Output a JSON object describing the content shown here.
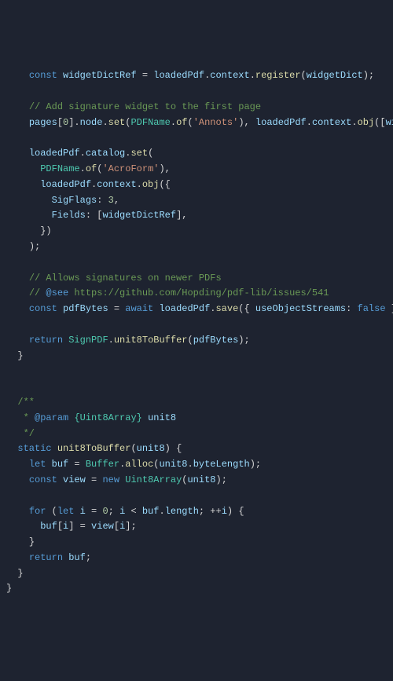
{
  "code": {
    "lines": [
      {
        "indent": "    ",
        "tokens": [
          {
            "cls": "kw",
            "t": "const"
          },
          {
            "cls": "punc",
            "t": " "
          },
          {
            "cls": "var",
            "t": "widgetDictRef"
          },
          {
            "cls": "punc",
            "t": " = "
          },
          {
            "cls": "var",
            "t": "loadedPdf"
          },
          {
            "cls": "punc",
            "t": "."
          },
          {
            "cls": "var",
            "t": "context"
          },
          {
            "cls": "punc",
            "t": "."
          },
          {
            "cls": "fn",
            "t": "register"
          },
          {
            "cls": "punc",
            "t": "("
          },
          {
            "cls": "var",
            "t": "widgetDict"
          },
          {
            "cls": "punc",
            "t": ");"
          }
        ]
      },
      {
        "indent": "",
        "tokens": []
      },
      {
        "indent": "    ",
        "tokens": [
          {
            "cls": "cmt",
            "t": "// Add signature widget to the first page"
          }
        ]
      },
      {
        "indent": "    ",
        "tokens": [
          {
            "cls": "var",
            "t": "pages"
          },
          {
            "cls": "punc",
            "t": "["
          },
          {
            "cls": "num",
            "t": "0"
          },
          {
            "cls": "punc",
            "t": "]."
          },
          {
            "cls": "var",
            "t": "node"
          },
          {
            "cls": "punc",
            "t": "."
          },
          {
            "cls": "fn",
            "t": "set"
          },
          {
            "cls": "punc",
            "t": "("
          },
          {
            "cls": "type",
            "t": "PDFName"
          },
          {
            "cls": "punc",
            "t": "."
          },
          {
            "cls": "fn",
            "t": "of"
          },
          {
            "cls": "punc",
            "t": "("
          },
          {
            "cls": "str",
            "t": "'Annots'"
          },
          {
            "cls": "punc",
            "t": "), "
          },
          {
            "cls": "var",
            "t": "loadedPdf"
          },
          {
            "cls": "punc",
            "t": "."
          },
          {
            "cls": "var",
            "t": "context"
          },
          {
            "cls": "punc",
            "t": "."
          },
          {
            "cls": "fn",
            "t": "obj"
          },
          {
            "cls": "punc",
            "t": "(["
          },
          {
            "cls": "var",
            "t": "widgetDictRef"
          },
          {
            "cls": "punc",
            "t": "]));"
          }
        ]
      },
      {
        "indent": "",
        "tokens": []
      },
      {
        "indent": "    ",
        "tokens": [
          {
            "cls": "var",
            "t": "loadedPdf"
          },
          {
            "cls": "punc",
            "t": "."
          },
          {
            "cls": "var",
            "t": "catalog"
          },
          {
            "cls": "punc",
            "t": "."
          },
          {
            "cls": "fn",
            "t": "set"
          },
          {
            "cls": "punc",
            "t": "("
          }
        ]
      },
      {
        "indent": "      ",
        "tokens": [
          {
            "cls": "type",
            "t": "PDFName"
          },
          {
            "cls": "punc",
            "t": "."
          },
          {
            "cls": "fn",
            "t": "of"
          },
          {
            "cls": "punc",
            "t": "("
          },
          {
            "cls": "str",
            "t": "'AcroForm'"
          },
          {
            "cls": "punc",
            "t": "),"
          }
        ]
      },
      {
        "indent": "      ",
        "tokens": [
          {
            "cls": "var",
            "t": "loadedPdf"
          },
          {
            "cls": "punc",
            "t": "."
          },
          {
            "cls": "var",
            "t": "context"
          },
          {
            "cls": "punc",
            "t": "."
          },
          {
            "cls": "fn",
            "t": "obj"
          },
          {
            "cls": "punc",
            "t": "({"
          }
        ]
      },
      {
        "indent": "        ",
        "tokens": [
          {
            "cls": "var",
            "t": "SigFlags"
          },
          {
            "cls": "punc",
            "t": ": "
          },
          {
            "cls": "num",
            "t": "3"
          },
          {
            "cls": "punc",
            "t": ","
          }
        ]
      },
      {
        "indent": "        ",
        "tokens": [
          {
            "cls": "var",
            "t": "Fields"
          },
          {
            "cls": "punc",
            "t": ": ["
          },
          {
            "cls": "var",
            "t": "widgetDictRef"
          },
          {
            "cls": "punc",
            "t": "],"
          }
        ]
      },
      {
        "indent": "      ",
        "tokens": [
          {
            "cls": "punc",
            "t": "})"
          }
        ]
      },
      {
        "indent": "    ",
        "tokens": [
          {
            "cls": "punc",
            "t": ");"
          }
        ]
      },
      {
        "indent": "",
        "tokens": []
      },
      {
        "indent": "    ",
        "tokens": [
          {
            "cls": "cmt",
            "t": "// Allows signatures on newer PDFs"
          }
        ]
      },
      {
        "indent": "    ",
        "tokens": [
          {
            "cls": "cmt",
            "t": "// "
          },
          {
            "cls": "doc-kw",
            "t": "@see"
          },
          {
            "cls": "cmt",
            "t": " https://github.com/Hopding/pdf-lib/issues/541"
          }
        ]
      },
      {
        "indent": "    ",
        "tokens": [
          {
            "cls": "kw",
            "t": "const"
          },
          {
            "cls": "punc",
            "t": " "
          },
          {
            "cls": "var",
            "t": "pdfBytes"
          },
          {
            "cls": "punc",
            "t": " = "
          },
          {
            "cls": "kw",
            "t": "await"
          },
          {
            "cls": "punc",
            "t": " "
          },
          {
            "cls": "var",
            "t": "loadedPdf"
          },
          {
            "cls": "punc",
            "t": "."
          },
          {
            "cls": "fn",
            "t": "save"
          },
          {
            "cls": "punc",
            "t": "({ "
          },
          {
            "cls": "var",
            "t": "useObjectStreams"
          },
          {
            "cls": "punc",
            "t": ": "
          },
          {
            "cls": "bool",
            "t": "false"
          },
          {
            "cls": "punc",
            "t": " });"
          }
        ]
      },
      {
        "indent": "",
        "tokens": []
      },
      {
        "indent": "    ",
        "tokens": [
          {
            "cls": "kw",
            "t": "return"
          },
          {
            "cls": "punc",
            "t": " "
          },
          {
            "cls": "type",
            "t": "SignPDF"
          },
          {
            "cls": "punc",
            "t": "."
          },
          {
            "cls": "fn",
            "t": "unit8ToBuffer"
          },
          {
            "cls": "punc",
            "t": "("
          },
          {
            "cls": "var",
            "t": "pdfBytes"
          },
          {
            "cls": "punc",
            "t": ");"
          }
        ]
      },
      {
        "indent": "  ",
        "tokens": [
          {
            "cls": "punc",
            "t": "}"
          }
        ]
      },
      {
        "indent": "",
        "tokens": []
      },
      {
        "indent": "",
        "tokens": []
      },
      {
        "indent": "  ",
        "tokens": [
          {
            "cls": "cmt",
            "t": "/**"
          }
        ]
      },
      {
        "indent": "   ",
        "tokens": [
          {
            "cls": "cmt",
            "t": "* "
          },
          {
            "cls": "doc-kw",
            "t": "@param"
          },
          {
            "cls": "cmt",
            "t": " "
          },
          {
            "cls": "type",
            "t": "{Uint8Array}"
          },
          {
            "cls": "cmt",
            "t": " "
          },
          {
            "cls": "var",
            "t": "unit8"
          }
        ]
      },
      {
        "indent": "   ",
        "tokens": [
          {
            "cls": "cmt",
            "t": "*/"
          }
        ]
      },
      {
        "indent": "  ",
        "tokens": [
          {
            "cls": "kw",
            "t": "static"
          },
          {
            "cls": "punc",
            "t": " "
          },
          {
            "cls": "fn",
            "t": "unit8ToBuffer"
          },
          {
            "cls": "punc",
            "t": "("
          },
          {
            "cls": "var",
            "t": "unit8"
          },
          {
            "cls": "punc",
            "t": ") {"
          }
        ]
      },
      {
        "indent": "    ",
        "tokens": [
          {
            "cls": "kw",
            "t": "let"
          },
          {
            "cls": "punc",
            "t": " "
          },
          {
            "cls": "var",
            "t": "buf"
          },
          {
            "cls": "punc",
            "t": " = "
          },
          {
            "cls": "type",
            "t": "Buffer"
          },
          {
            "cls": "punc",
            "t": "."
          },
          {
            "cls": "fn",
            "t": "alloc"
          },
          {
            "cls": "punc",
            "t": "("
          },
          {
            "cls": "var",
            "t": "unit8"
          },
          {
            "cls": "punc",
            "t": "."
          },
          {
            "cls": "var",
            "t": "byteLength"
          },
          {
            "cls": "punc",
            "t": ");"
          }
        ]
      },
      {
        "indent": "    ",
        "tokens": [
          {
            "cls": "kw",
            "t": "const"
          },
          {
            "cls": "punc",
            "t": " "
          },
          {
            "cls": "var",
            "t": "view"
          },
          {
            "cls": "punc",
            "t": " = "
          },
          {
            "cls": "kw",
            "t": "new"
          },
          {
            "cls": "punc",
            "t": " "
          },
          {
            "cls": "type",
            "t": "Uint8Array"
          },
          {
            "cls": "punc",
            "t": "("
          },
          {
            "cls": "var",
            "t": "unit8"
          },
          {
            "cls": "punc",
            "t": ");"
          }
        ]
      },
      {
        "indent": "",
        "tokens": []
      },
      {
        "indent": "    ",
        "tokens": [
          {
            "cls": "kw",
            "t": "for"
          },
          {
            "cls": "punc",
            "t": " ("
          },
          {
            "cls": "kw",
            "t": "let"
          },
          {
            "cls": "punc",
            "t": " "
          },
          {
            "cls": "var",
            "t": "i"
          },
          {
            "cls": "punc",
            "t": " = "
          },
          {
            "cls": "num",
            "t": "0"
          },
          {
            "cls": "punc",
            "t": "; "
          },
          {
            "cls": "var",
            "t": "i"
          },
          {
            "cls": "punc",
            "t": " < "
          },
          {
            "cls": "var",
            "t": "buf"
          },
          {
            "cls": "punc",
            "t": "."
          },
          {
            "cls": "var",
            "t": "length"
          },
          {
            "cls": "punc",
            "t": "; ++"
          },
          {
            "cls": "var",
            "t": "i"
          },
          {
            "cls": "punc",
            "t": ") {"
          }
        ]
      },
      {
        "indent": "      ",
        "tokens": [
          {
            "cls": "var",
            "t": "buf"
          },
          {
            "cls": "punc",
            "t": "["
          },
          {
            "cls": "var",
            "t": "i"
          },
          {
            "cls": "punc",
            "t": "] = "
          },
          {
            "cls": "var",
            "t": "view"
          },
          {
            "cls": "punc",
            "t": "["
          },
          {
            "cls": "var",
            "t": "i"
          },
          {
            "cls": "punc",
            "t": "];"
          }
        ]
      },
      {
        "indent": "    ",
        "tokens": [
          {
            "cls": "punc",
            "t": "}"
          }
        ]
      },
      {
        "indent": "    ",
        "tokens": [
          {
            "cls": "kw",
            "t": "return"
          },
          {
            "cls": "punc",
            "t": " "
          },
          {
            "cls": "var",
            "t": "buf"
          },
          {
            "cls": "punc",
            "t": ";"
          }
        ]
      },
      {
        "indent": "  ",
        "tokens": [
          {
            "cls": "punc",
            "t": "}"
          }
        ]
      },
      {
        "indent": "",
        "tokens": [
          {
            "cls": "punc",
            "t": "}"
          }
        ]
      }
    ]
  }
}
